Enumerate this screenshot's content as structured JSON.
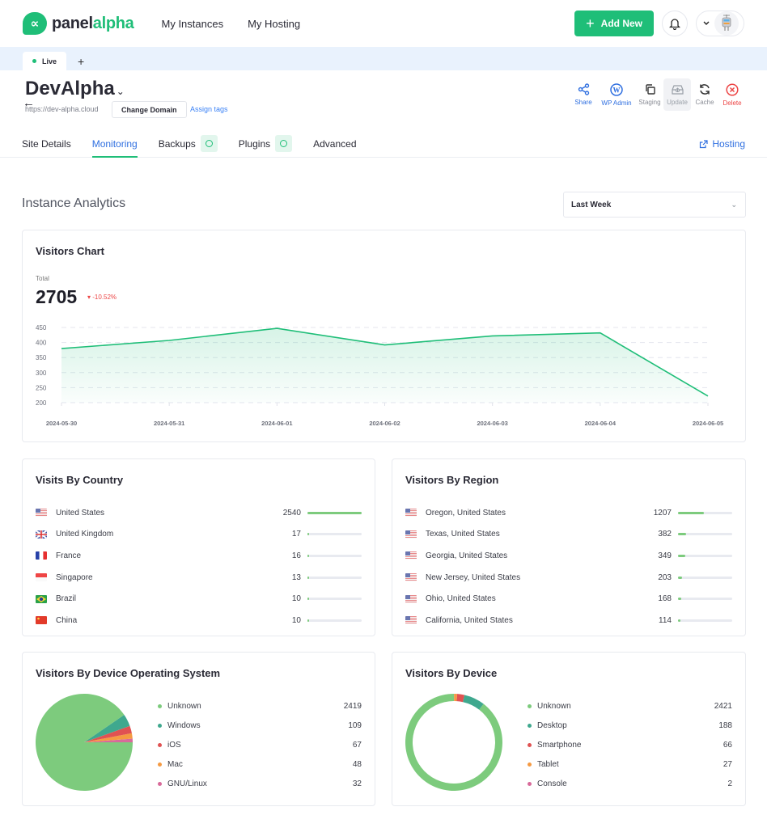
{
  "app": {
    "brand_part1": "panel",
    "brand_part2": "alpha",
    "logo_glyph": "∝"
  },
  "nav": [
    "My Instances",
    "My Hosting"
  ],
  "top_actions": {
    "add_new": "Add New",
    "bell_icon": "bell-icon",
    "user_menu_icon": "chevron-down-icon"
  },
  "env_tabs": {
    "active": "Live",
    "add": "+"
  },
  "site": {
    "title": "DevAlpha",
    "url": "https://dev-alpha.cloud",
    "change_domain": "Change Domain",
    "assign_tags": "Assign tags"
  },
  "site_actions": [
    {
      "label": "Share",
      "icon": "share-icon"
    },
    {
      "label": "WP Admin",
      "icon": "wordpress-icon"
    },
    {
      "label": "Staging",
      "icon": "copy-icon"
    },
    {
      "label": "Update",
      "icon": "update-icon"
    },
    {
      "label": "Cache",
      "icon": "refresh-icon"
    },
    {
      "label": "Delete",
      "icon": "delete-icon"
    }
  ],
  "tabs": [
    {
      "label": "Site Details",
      "active": false
    },
    {
      "label": "Monitoring",
      "active": true
    },
    {
      "label": "Backups",
      "check": true
    },
    {
      "label": "Plugins",
      "check": true
    },
    {
      "label": "Advanced"
    }
  ],
  "hosting_link": "Hosting",
  "analytics": {
    "title": "Instance Analytics",
    "range": "Last Week"
  },
  "visitors_card": {
    "title": "Visitors Chart",
    "total_label": "Total",
    "total": "2705",
    "delta": "-10.52%"
  },
  "colors": {
    "brand": "#1fbe78",
    "link": "#2f6fe0",
    "danger": "#ec4545",
    "bar": "#7dcb7d"
  },
  "chart_data": [
    {
      "type": "area",
      "title": "Visitors Chart",
      "x": [
        "2024-05-30",
        "2024-05-31",
        "2024-06-01",
        "2024-06-02",
        "2024-06-03",
        "2024-06-04",
        "2024-06-05"
      ],
      "series": [
        {
          "name": "Visitors",
          "values": [
            380,
            407,
            447,
            392,
            422,
            432,
            222
          ]
        }
      ],
      "yticks": [
        200,
        250,
        300,
        350,
        400,
        450
      ],
      "ylim": [
        200,
        450
      ],
      "grid": true
    },
    {
      "type": "pie",
      "title": "Visitors By Device Operating System",
      "labels": [
        "Unknown",
        "Windows",
        "iOS",
        "Mac",
        "GNU/Linux"
      ],
      "values": [
        2419,
        109,
        67,
        48,
        32
      ],
      "colors": [
        "#7dcb7d",
        "#3fa88e",
        "#e05252",
        "#f59a42",
        "#d86a9a"
      ]
    },
    {
      "type": "pie",
      "subtype": "donut",
      "title": "Visitors By Device",
      "labels": [
        "Unknown",
        "Desktop",
        "Smartphone",
        "Tablet",
        "Console"
      ],
      "values": [
        2421,
        188,
        66,
        27,
        2
      ],
      "colors": [
        "#7dcb7d",
        "#3fa88e",
        "#e05252",
        "#f59a42",
        "#d86a9a"
      ]
    }
  ],
  "country": {
    "title": "Visits By Country",
    "rows": [
      {
        "name": "United States",
        "value": 2540,
        "flag": "us"
      },
      {
        "name": "United Kingdom",
        "value": 17,
        "flag": "gb"
      },
      {
        "name": "France",
        "value": 16,
        "flag": "fr"
      },
      {
        "name": "Singapore",
        "value": 13,
        "flag": "sg"
      },
      {
        "name": "Brazil",
        "value": 10,
        "flag": "br"
      },
      {
        "name": "China",
        "value": 10,
        "flag": "cn"
      }
    ]
  },
  "region": {
    "title": "Visitors By Region",
    "rows": [
      {
        "name": "Oregon, United States",
        "value": 1207,
        "flag": "us"
      },
      {
        "name": "Texas, United States",
        "value": 382,
        "flag": "us"
      },
      {
        "name": "Georgia, United States",
        "value": 349,
        "flag": "us"
      },
      {
        "name": "New Jersey, United States",
        "value": 203,
        "flag": "us"
      },
      {
        "name": "Ohio, United States",
        "value": 168,
        "flag": "us"
      },
      {
        "name": "California, United States",
        "value": 114,
        "flag": "us"
      }
    ]
  },
  "os_card": {
    "title": "Visitors By Device Operating System"
  },
  "device_card": {
    "title": "Visitors By Device"
  }
}
